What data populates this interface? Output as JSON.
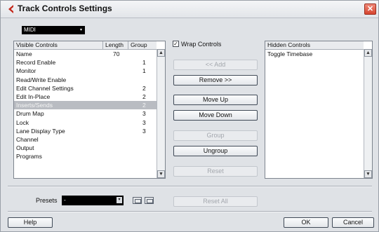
{
  "window": {
    "title": "Track Controls Settings",
    "close_glyph": "✕"
  },
  "track_type": {
    "selected": "MIDI",
    "arrow": "▾"
  },
  "visible_controls": {
    "headers": [
      "Visible Controls",
      "Length",
      "Group"
    ],
    "rows": [
      {
        "name": "Name",
        "length": "70",
        "group": ""
      },
      {
        "name": "Record Enable",
        "length": "",
        "group": "1"
      },
      {
        "name": "Monitor",
        "length": "",
        "group": "1"
      },
      {
        "name": "Read/Write Enable",
        "length": "",
        "group": ""
      },
      {
        "name": "Edit Channel Settings",
        "length": "",
        "group": "2"
      },
      {
        "name": "Edit In-Place",
        "length": "",
        "group": "2"
      },
      {
        "name": "Inserts/Sends",
        "length": "",
        "group": "2",
        "selected": true
      },
      {
        "name": "Drum Map",
        "length": "",
        "group": "3"
      },
      {
        "name": "Lock",
        "length": "",
        "group": "3"
      },
      {
        "name": "Lane Display Type",
        "length": "",
        "group": "3"
      },
      {
        "name": "Channel",
        "length": "",
        "group": ""
      },
      {
        "name": "Output",
        "length": "",
        "group": ""
      },
      {
        "name": "Programs",
        "length": "",
        "group": ""
      }
    ]
  },
  "wrap_controls": {
    "label": "Wrap Controls",
    "checked": true,
    "mark": "✓"
  },
  "buttons": {
    "add": "<< Add",
    "remove": "Remove >>",
    "move_up": "Move Up",
    "move_down": "Move Down",
    "group": "Group",
    "ungroup": "Ungroup",
    "reset": "Reset",
    "reset_all": "Reset All",
    "help": "Help",
    "ok": "OK",
    "cancel": "Cancel"
  },
  "hidden_controls": {
    "header": "Hidden Controls",
    "rows": [
      "Toggle Timebase"
    ]
  },
  "presets": {
    "label": "Presets",
    "value": "-",
    "arrow": "▾"
  },
  "scroll": {
    "up": "▲",
    "down": "▼"
  }
}
